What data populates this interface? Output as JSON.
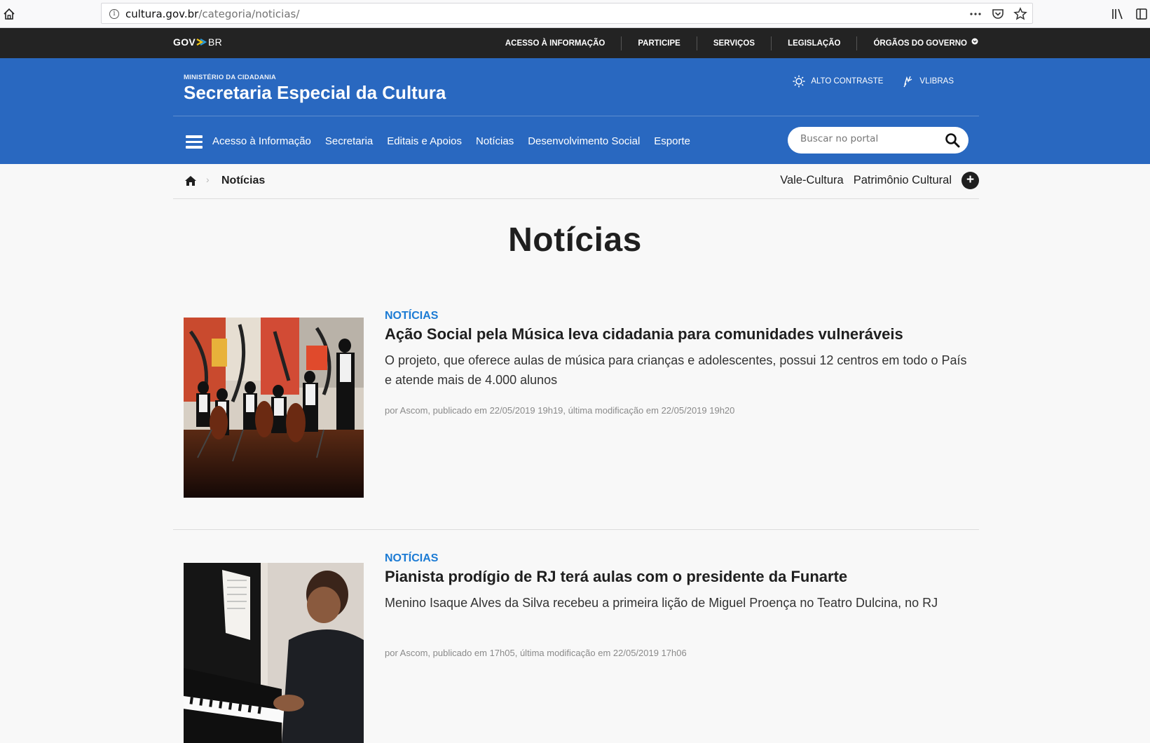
{
  "browser": {
    "url_host": "cultura.gov.br",
    "url_path": "/categoria/noticias/"
  },
  "govbar": {
    "logo_gov": "GOV",
    "logo_br": "BR",
    "links": [
      "ACESSO À INFORMAÇÃO",
      "PARTICIPE",
      "SERVIÇOS",
      "LEGISLAÇÃO",
      "ÓRGÃOS DO GOVERNO"
    ]
  },
  "header": {
    "ministry": "MINISTÉRIO DA CIDADANIA",
    "title": "Secretaria Especial da Cultura",
    "tool_contrast": "ALTO CONTRASTE",
    "tool_vlibras": "VLIBRAS",
    "nav": [
      "Acesso à Informação",
      "Secretaria",
      "Editais e Apoios",
      "Notícias",
      "Desenvolvimento Social",
      "Esporte"
    ],
    "search_placeholder": "Buscar no portal"
  },
  "breadcrumb": {
    "current": "Notícias",
    "quicklinks": [
      "Vale-Cultura",
      "Patrimônio Cultural"
    ],
    "plus": "+"
  },
  "page": {
    "title": "Notícias"
  },
  "articles": [
    {
      "category": "NOTÍCIAS",
      "title": "Ação Social pela Música leva cidadania para comunidades vulneráveis",
      "description": "O projeto, que oferece aulas de música para crianças e adolescentes, possui 12 centros em todo o País e atende mais de 4.000 alunos",
      "meta": "por Ascom, publicado em 22/05/2019 19h19, última modificação em 22/05/2019 19h20"
    },
    {
      "category": "NOTÍCIAS",
      "title": "Pianista prodígio de RJ terá aulas com o presidente da Funarte",
      "description": "Menino Isaque Alves da Silva recebeu a primeira lição de Miguel Proença no Teatro Dulcina, no RJ",
      "meta": "por Ascom, publicado em 17h05, última modificação em 22/05/2019 17h06"
    }
  ],
  "colors": {
    "header_blue": "#2968c0",
    "govbar_dark": "#232323",
    "category_blue": "#1c7bd4"
  },
  "icons": [
    "home-icon",
    "info-icon",
    "more-icon",
    "pocket-icon",
    "bookmark-star-icon",
    "library-icon",
    "sidebar-icon",
    "contrast-icon",
    "vlibras-icon",
    "menu-icon",
    "search-icon",
    "breadcrumb-home-icon",
    "plus-icon"
  ]
}
